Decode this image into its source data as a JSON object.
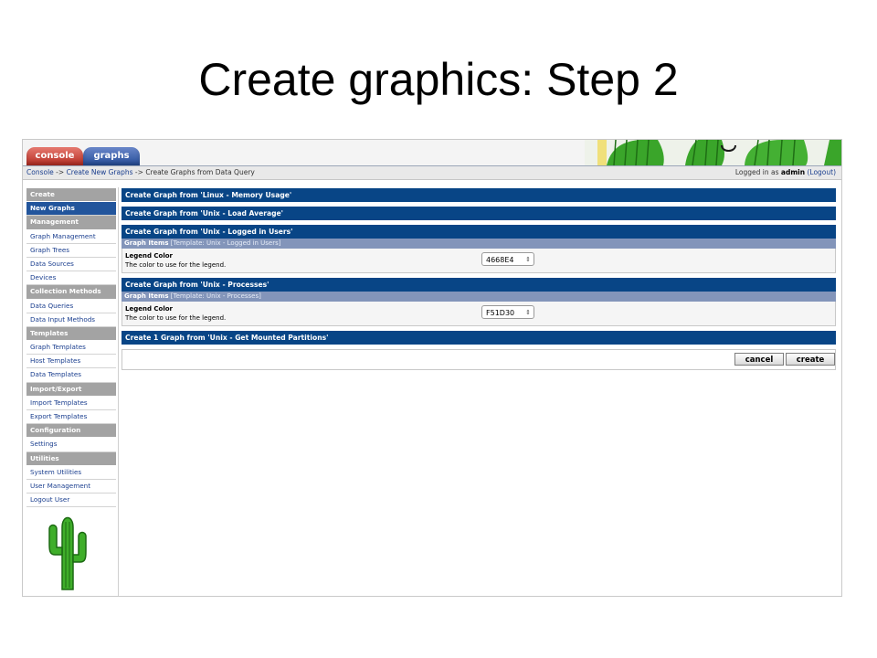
{
  "slide": {
    "title": "Create graphics: Step 2"
  },
  "tabs": {
    "console": "console",
    "graphs": "graphs"
  },
  "breadcrumb": {
    "items": [
      "Console",
      "Create New Graphs",
      "Create Graphs from Data Query"
    ],
    "separator": "->"
  },
  "login": {
    "prefix": "Logged in as",
    "user": "admin",
    "logout": "(Logout)"
  },
  "sidebar": {
    "items": [
      {
        "label": "Create",
        "type": "header"
      },
      {
        "label": "New Graphs",
        "type": "selected"
      },
      {
        "label": "Management",
        "type": "header"
      },
      {
        "label": "Graph Management",
        "type": "link"
      },
      {
        "label": "Graph Trees",
        "type": "link"
      },
      {
        "label": "Data Sources",
        "type": "link"
      },
      {
        "label": "Devices",
        "type": "link"
      },
      {
        "label": "Collection Methods",
        "type": "header"
      },
      {
        "label": "Data Queries",
        "type": "link"
      },
      {
        "label": "Data Input Methods",
        "type": "link"
      },
      {
        "label": "Templates",
        "type": "header"
      },
      {
        "label": "Graph Templates",
        "type": "link"
      },
      {
        "label": "Host Templates",
        "type": "link"
      },
      {
        "label": "Data Templates",
        "type": "link"
      },
      {
        "label": "Import/Export",
        "type": "header"
      },
      {
        "label": "Import Templates",
        "type": "link"
      },
      {
        "label": "Export Templates",
        "type": "link"
      },
      {
        "label": "Configuration",
        "type": "header"
      },
      {
        "label": "Settings",
        "type": "link"
      },
      {
        "label": "Utilities",
        "type": "header"
      },
      {
        "label": "System Utilities",
        "type": "link"
      },
      {
        "label": "User Management",
        "type": "link"
      },
      {
        "label": "Logout User",
        "type": "link"
      }
    ]
  },
  "main": {
    "sections": {
      "linux_memory": {
        "title": "Create Graph from 'Linux - Memory Usage'"
      },
      "unix_load": {
        "title": "Create Graph from 'Unix - Load Average'"
      },
      "unix_users": {
        "title": "Create Graph from 'Unix - Logged in Users'",
        "sub_label": "Graph Items",
        "sub_template": "[Template: Unix - Logged in Users]",
        "field_label": "Legend Color",
        "field_desc": "The color to use for the legend.",
        "color_value": "4668E4"
      },
      "unix_processes": {
        "title": "Create Graph from 'Unix - Processes'",
        "sub_label": "Graph Items",
        "sub_template": "[Template: Unix - Processes]",
        "field_label": "Legend Color",
        "field_desc": "The color to use for the legend.",
        "color_value": "F51D30"
      },
      "unix_partitions": {
        "title": "Create 1 Graph from 'Unix - Get Mounted Partitions'"
      }
    },
    "buttons": {
      "cancel": "cancel",
      "create": "create"
    }
  },
  "colors": {
    "header_blue": "#084586",
    "sub_header": "#8395ba",
    "console_tab": "#b52c22",
    "graphs_tab": "#254d99",
    "sidebar_header": "#a3a3a3"
  }
}
